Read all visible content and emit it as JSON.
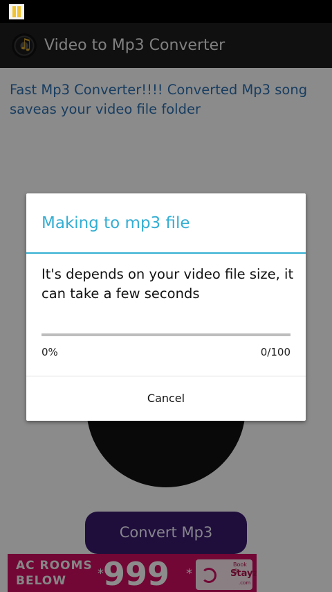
{
  "app": {
    "title": "Video to Mp3 Converter",
    "icon": "music-note-icon"
  },
  "main": {
    "intro": "Fast Mp3 Converter!!!! Converted Mp3 song saveas your video file folder",
    "convert_label": "Convert Mp3"
  },
  "ad": {
    "left_text": "AC ROOMS\nBELOW",
    "price": "999",
    "star": "*",
    "book_text": "Book @",
    "brand": "Stayzilla",
    "brand_suffix": ".com",
    "color": "#cf0e62"
  },
  "dialog": {
    "title": "Making to mp3 file",
    "message": "It's depends on your video file size, it can take a few seconds",
    "progress_percent_label": "0%",
    "progress_count_label": "0/100",
    "progress_value": 0,
    "cancel_label": "Cancel",
    "accent_color": "#33aed3"
  }
}
